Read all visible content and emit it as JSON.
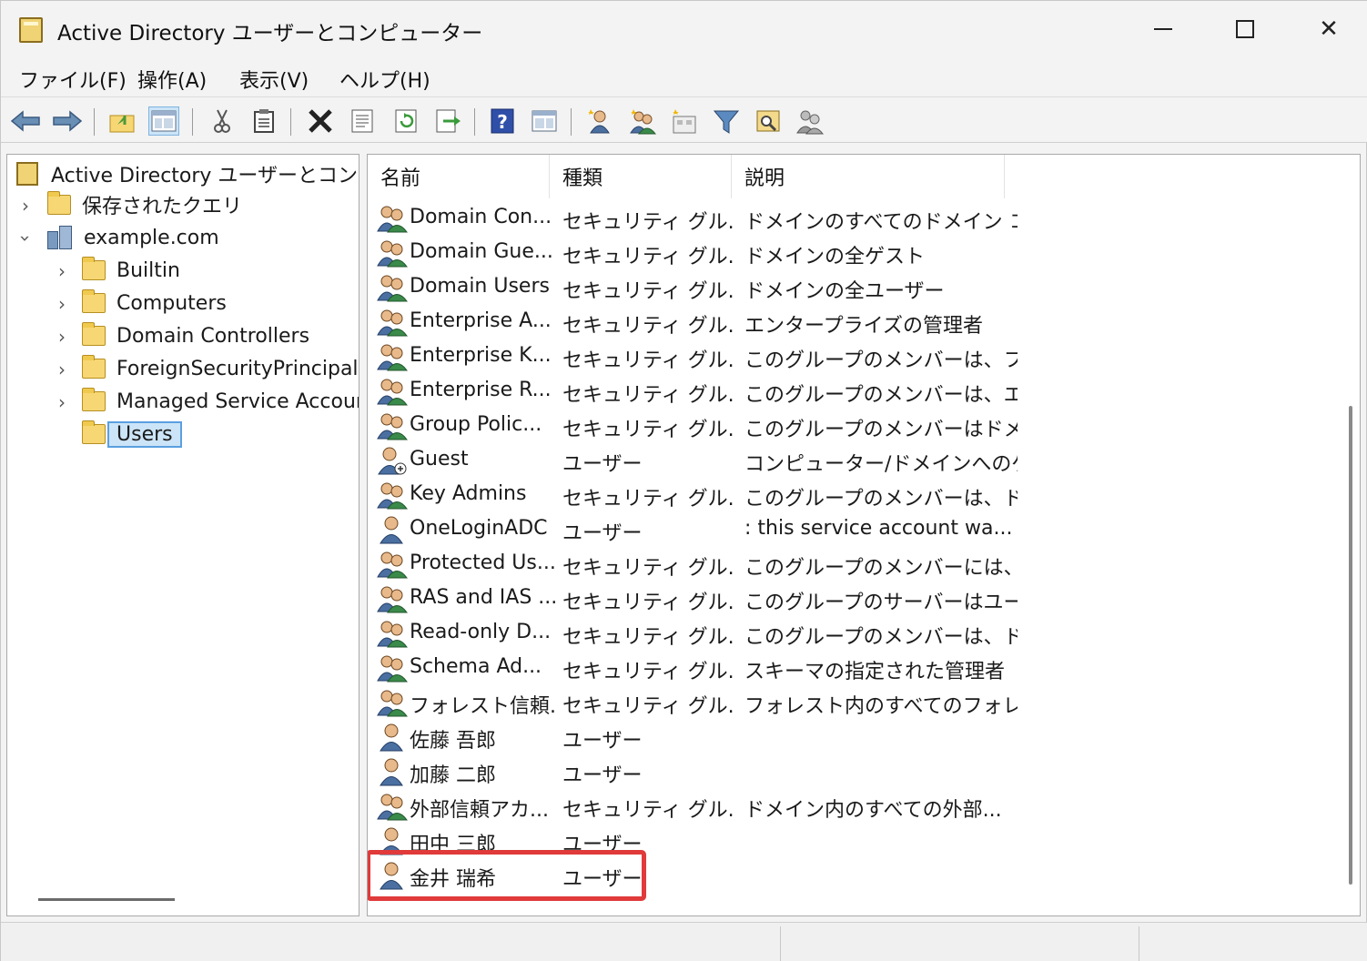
{
  "window": {
    "title": "Active Directory ユーザーとコンピューター"
  },
  "menu": {
    "file": "ファイル(F)",
    "action": "操作(A)",
    "view": "表示(V)",
    "help": "ヘルプ(H)"
  },
  "toolbar": {
    "icons": [
      "back-icon",
      "forward-icon",
      "up-folder-icon",
      "show-hide-tree-icon",
      "cut-icon",
      "paste-icon",
      "delete-icon",
      "properties-icon",
      "refresh-icon",
      "export-icon",
      "help-icon",
      "console-icon",
      "new-user-icon",
      "new-group-icon",
      "new-ou-icon",
      "filter-icon",
      "find-icon",
      "add-to-group-icon"
    ]
  },
  "tree": {
    "root": "Active Directory ユーザーとコンピュー",
    "saved_queries": "保存されたクエリ",
    "domain": "example.com",
    "items": [
      "Builtin",
      "Computers",
      "Domain Controllers",
      "ForeignSecurityPrincipals",
      "Managed Service Accour",
      "Users"
    ],
    "selected": "Users"
  },
  "list": {
    "headers": {
      "name": "名前",
      "type": "種類",
      "description": "説明"
    },
    "rows": [
      {
        "kind": "group",
        "name": "Domain Con...",
        "type": "セキュリティ グル...",
        "description": "ドメインのすべてのドメイン コ..."
      },
      {
        "kind": "group",
        "name": "Domain Gue...",
        "type": "セキュリティ グル...",
        "description": "ドメインの全ゲスト"
      },
      {
        "kind": "group",
        "name": "Domain Users",
        "type": "セキュリティ グル...",
        "description": "ドメインの全ユーザー"
      },
      {
        "kind": "group",
        "name": "Enterprise A...",
        "type": "セキュリティ グル...",
        "description": "エンタープライズの管理者"
      },
      {
        "kind": "group",
        "name": "Enterprise K...",
        "type": "セキュリティ グル...",
        "description": "このグループのメンバーは、フ..."
      },
      {
        "kind": "group",
        "name": "Enterprise R...",
        "type": "セキュリティ グル...",
        "description": "このグループのメンバーは、エ..."
      },
      {
        "kind": "group",
        "name": "Group Polic...",
        "type": "セキュリティ グル...",
        "description": "このグループのメンバーはドメ..."
      },
      {
        "kind": "guest",
        "name": "Guest",
        "type": "ユーザー",
        "description": "コンピューター/ドメインへのゲ..."
      },
      {
        "kind": "group",
        "name": "Key Admins",
        "type": "セキュリティ グル...",
        "description": "このグループのメンバーは、ド..."
      },
      {
        "kind": "user",
        "name": "OneLoginADC",
        "type": "ユーザー",
        "description": ": this service account wa..."
      },
      {
        "kind": "group",
        "name": "Protected Us...",
        "type": "セキュリティ グル...",
        "description": "このグループのメンバーには、..."
      },
      {
        "kind": "group",
        "name": "RAS and IAS ...",
        "type": "セキュリティ グル...",
        "description": "このグループのサーバーはユー..."
      },
      {
        "kind": "group",
        "name": "Read-only D...",
        "type": "セキュリティ グル...",
        "description": "このグループのメンバーは、ド..."
      },
      {
        "kind": "group",
        "name": "Schema Ad...",
        "type": "セキュリティ グル...",
        "description": "スキーマの指定された管理者"
      },
      {
        "kind": "group",
        "name": "フォレスト信頼...",
        "type": "セキュリティ グル...",
        "description": "フォレスト内のすべてのフォレ..."
      },
      {
        "kind": "user",
        "name": "佐藤 吾郎",
        "type": "ユーザー",
        "description": ""
      },
      {
        "kind": "user",
        "name": "加藤 二郎",
        "type": "ユーザー",
        "description": ""
      },
      {
        "kind": "group",
        "name": "外部信頼アカ...",
        "type": "セキュリティ グル...",
        "description": "ドメイン内のすべての外部..."
      },
      {
        "kind": "user",
        "name": "田中 三郎",
        "type": "ユーザー",
        "description": ""
      },
      {
        "kind": "user",
        "name": "金井 瑞希",
        "type": "ユーザー",
        "description": "",
        "highlighted": true
      }
    ]
  },
  "colors": {
    "highlight": "#e03a3a",
    "selection": "#cce4f7",
    "folder": "#f7d774"
  }
}
